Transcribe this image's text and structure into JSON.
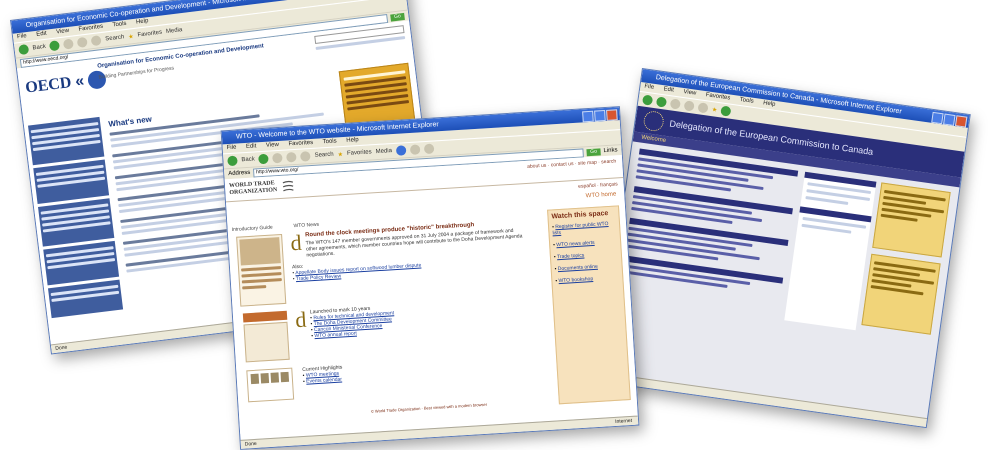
{
  "windows": {
    "oecd": {
      "title": "Organisation for Economic Co-operation and Development - Microsoft Internet Explorer",
      "menu": [
        "File",
        "Edit",
        "View",
        "Favorites",
        "Tools",
        "Help"
      ],
      "toolbar": {
        "back": "Back",
        "search": "Search",
        "favorites": "Favorites",
        "media": "Media"
      },
      "address": "http://www.oecd.org/",
      "go": "Go",
      "logo_text": "OECD",
      "header_title": "Organisation for Economic Co-operation and Development",
      "header_sub": "Building Partnerships for Progress",
      "main_heading": "What's new",
      "status": "Done"
    },
    "wto": {
      "title": "WTO - Welcome to the WTO website - Microsoft Internet Explorer",
      "menu": [
        "File",
        "Edit",
        "View",
        "Favorites",
        "Tools",
        "Help"
      ],
      "toolbar": {
        "back": "Back",
        "search": "Search",
        "favorites": "Favorites",
        "media": "Media"
      },
      "address_label": "Address",
      "address": "http://www.wto.org/",
      "go": "Go",
      "links": "Links",
      "logo_line1": "WORLD TRADE",
      "logo_line2": "ORGANIZATION",
      "top_links": "about us · contact us · site map · search",
      "lang": "español · français",
      "home_label": "WTO home",
      "side_a": "Introductory Guide",
      "side_b": "WTO News",
      "news_heading": "Round the clock meetings produce \"historic\" breakthrough",
      "news_body": "The WTO's 147 member governments approved on 31 July 2004 a package of framework and other agreements, which member countries hope will contribute to the Doha Development Agenda negotiations.",
      "also_label": "Also:",
      "bullet1": "Appellate Body issues report on softwood lumber dispute",
      "bullet2": "Trade Policy Review",
      "section2_heading": "Launched to mark 10 years",
      "list2": [
        "Rules for technical and development",
        "The Doha Development Committee",
        "Cancún Ministerial Conference",
        "WTO annual report"
      ],
      "section3_heading": "Current Highlights",
      "list3": [
        "WTO meetings",
        "Events calendar"
      ],
      "right_box_title": "Watch this space",
      "right_links": [
        "Register for public WTO lists",
        "WTO news alerts",
        "Trade topics",
        "Documents online",
        "WTO bookshop"
      ],
      "footer": "© World Trade Organization · Best viewed with a modern browser",
      "status": "Done",
      "zone": "Internet"
    },
    "eu": {
      "title": "Delegation of the European Commission to Canada - Microsoft Internet Explorer",
      "menu": [
        "File",
        "Edit",
        "View",
        "Favorites",
        "Tools",
        "Help"
      ],
      "banner": "Delegation of the European Commission to Canada",
      "sub": "Welcome",
      "status": "Done"
    }
  },
  "colors": {
    "xp_blue": "#1d4fb7",
    "eu_navy": "#2a2f7a",
    "eu_yellow": "#f1d479",
    "wto_box": "#f7e2bd",
    "oecd_nav": "#3f5d9e"
  }
}
